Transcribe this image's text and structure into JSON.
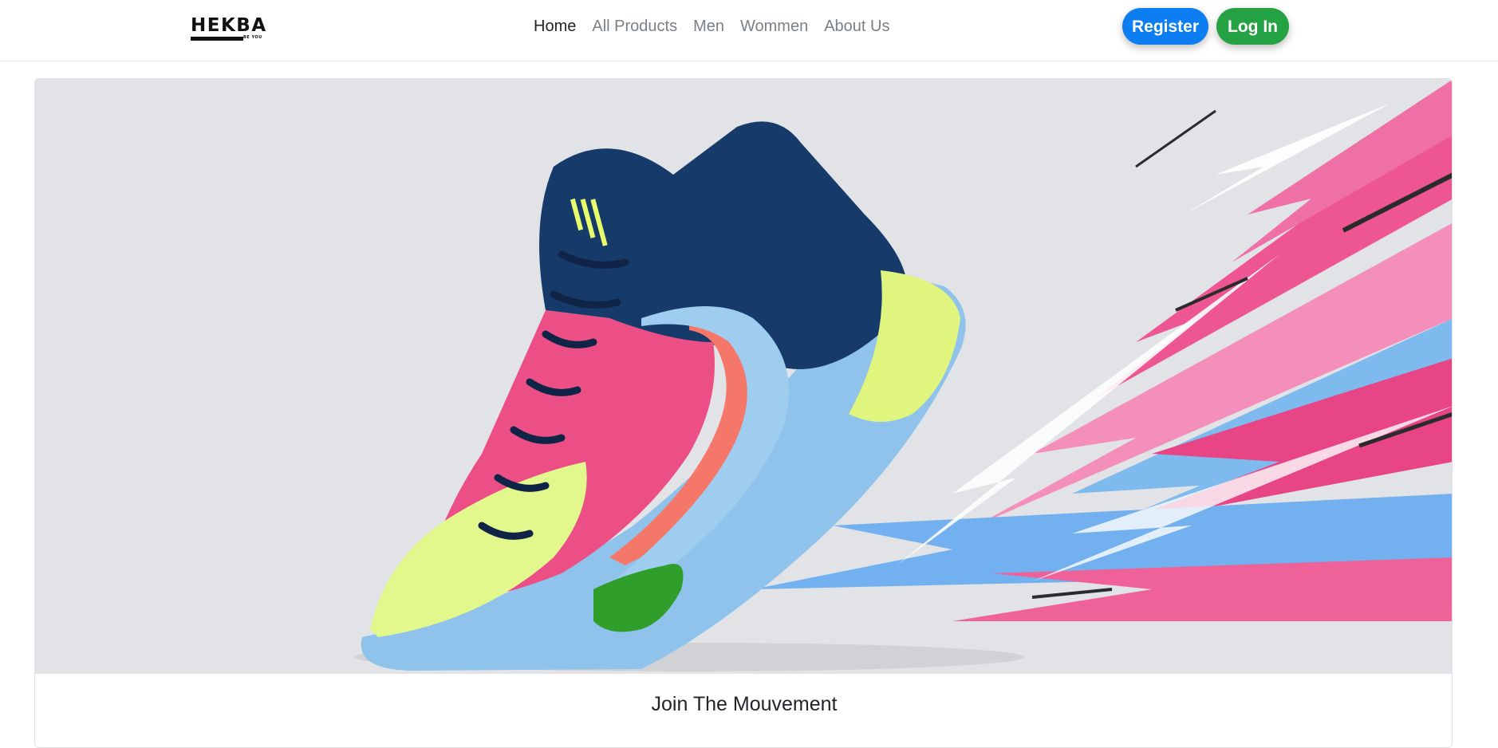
{
  "brand": {
    "name": "HEKBA",
    "tagline": "BE YOU"
  },
  "nav": {
    "links": [
      "Home",
      "All Products",
      "Men",
      "Wommen",
      "About Us"
    ],
    "active": "Home"
  },
  "auth": {
    "register_label": "Register",
    "login_label": "Log In"
  },
  "hero": {
    "image": "sneaker-hero",
    "card_title": "Join The Mouvement"
  },
  "colors": {
    "register": "#0d7ef2",
    "login": "#25a244",
    "hero_bg": "#e2e3e6"
  }
}
